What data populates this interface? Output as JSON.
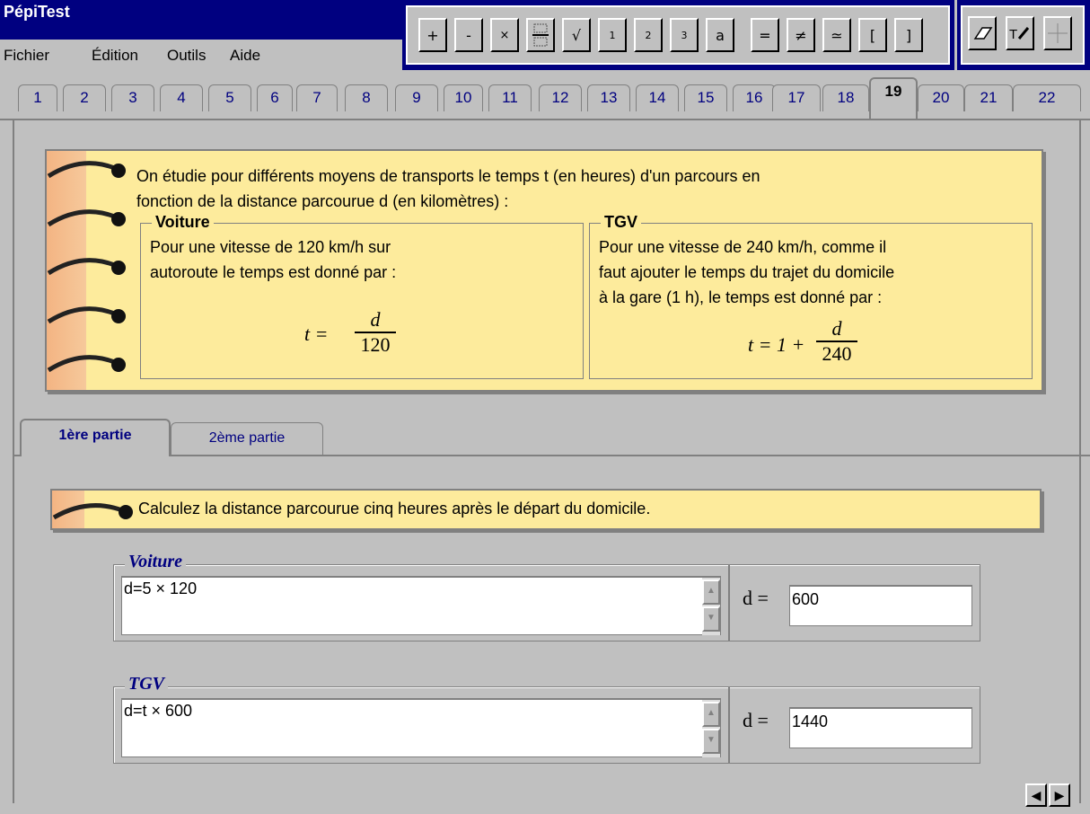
{
  "app": {
    "title": "PépiTest"
  },
  "menu": [
    {
      "label": "Fichier"
    },
    {
      "label": "Édition"
    },
    {
      "label": "Outils"
    },
    {
      "label": "Aide"
    }
  ],
  "math_toolbar": [
    {
      "label": "+",
      "icon": "plus-icon"
    },
    {
      "label": "-",
      "icon": "minus-icon"
    },
    {
      "label": "×",
      "icon": "times-icon"
    },
    {
      "label": "",
      "icon": "fraction-icon"
    },
    {
      "label": "√",
      "icon": "sqrt-icon"
    },
    {
      "label": "1",
      "icon": "exponent-1-icon"
    },
    {
      "label": "2",
      "icon": "exponent-2-icon"
    },
    {
      "label": "3",
      "icon": "exponent-3-icon"
    },
    {
      "label": "a",
      "icon": "power-icon"
    },
    {
      "label": "=",
      "icon": "equals-icon"
    },
    {
      "label": "≠",
      "icon": "not-equal-icon"
    },
    {
      "label": "≃",
      "icon": "approx-icon"
    },
    {
      "label": "[",
      "icon": "left-bracket-icon"
    },
    {
      "label": "]",
      "icon": "right-bracket-icon"
    }
  ],
  "tools": [
    {
      "icon": "eraser-icon"
    },
    {
      "icon": "text-pen-icon"
    },
    {
      "icon": "crosshair-icon"
    }
  ],
  "tabs": [
    "1",
    "2",
    "3",
    "4",
    "5",
    "6",
    "7",
    "8",
    "9",
    "10",
    "11",
    "12",
    "13",
    "14",
    "15",
    "16",
    "17",
    "18",
    "19",
    "20",
    "21",
    "22"
  ],
  "active_tab": "19",
  "intro": {
    "text_line1": "On étudie pour différents moyens de transports le temps t (en heures) d'un parcours en",
    "text_line2": "fonction de la distance parcourue d (en kilomètres) :",
    "voiture": {
      "title": "Voiture",
      "line1": "Pour une vitesse de 120 km/h sur",
      "line2": "autoroute le temps est donné par :",
      "formula_lhs": "t =",
      "formula_num": "d",
      "formula_den": "120"
    },
    "tgv": {
      "title": "TGV",
      "line1": "Pour une vitesse de 240 km/h, comme il",
      "line2": "faut ajouter le temps du trajet du domicile",
      "line3": "à la gare (1 h), le temps est donné par :",
      "formula_lhs": "t = 1 +",
      "formula_num": "d",
      "formula_den": "240"
    }
  },
  "subtabs": [
    {
      "label": "1ère partie",
      "active": true
    },
    {
      "label": "2ème partie",
      "active": false
    }
  ],
  "question": "Calculez la distance parcourue cinq heures après le départ du domicile.",
  "answers": [
    {
      "title": "Voiture",
      "work": "d=5 × 120",
      "result_label": "d =",
      "result": "600"
    },
    {
      "title": "TGV",
      "work": "d=t × 600",
      "result_label": "d =",
      "result": "1440"
    }
  ],
  "nav": {
    "prev": "◀",
    "next": "▶"
  }
}
